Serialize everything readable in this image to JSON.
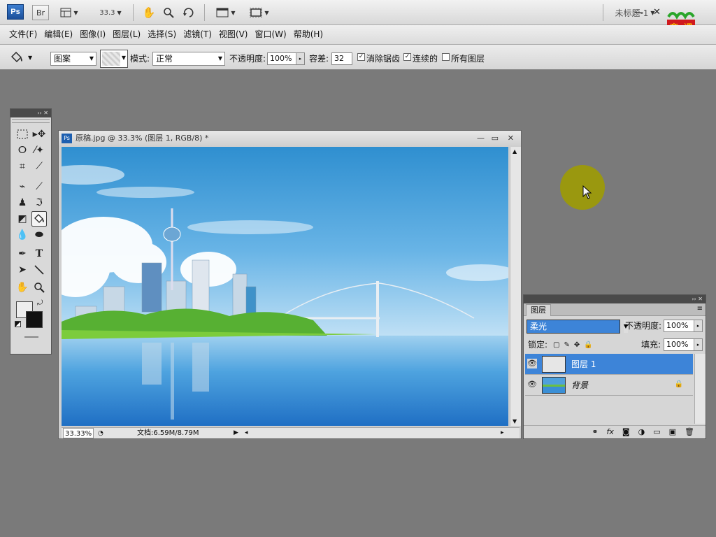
{
  "appbar": {
    "ps_logo": "Ps",
    "br_button": "Br",
    "zoom_value": "33.3",
    "doc_name": "未标题-1",
    "icons": [
      "bridge-icon",
      "layout-icon",
      "zoom-dropdown",
      "hand-icon",
      "zoom-icon",
      "rotate-icon",
      "arrange-icon",
      "screen-mode-icon"
    ]
  },
  "window_controls": {
    "minimize": "—",
    "restore": "❐",
    "close": "✕"
  },
  "menu": {
    "items": [
      "文件(F)",
      "编辑(E)",
      "图像(I)",
      "图层(L)",
      "选择(S)",
      "滤镜(T)",
      "视图(V)",
      "窗口(W)",
      "帮助(H)"
    ]
  },
  "options": {
    "fill_source": "图案",
    "mode_label": "模式:",
    "mode_value": "正常",
    "opacity_label": "不透明度:",
    "opacity_value": "100%",
    "tolerance_label": "容差:",
    "tolerance_value": "32",
    "antialias_label": "消除锯齿",
    "contiguous_label": "连续的",
    "all_layers_label": "所有图层",
    "antialias_checked": true,
    "contiguous_checked": true,
    "all_layers_checked": false
  },
  "logo": {
    "line1": "育",
    "line2": "课",
    "line3": "教育",
    "color": "#d0191e"
  },
  "tools_panel": {
    "active": "paint-bucket-tool"
  },
  "document": {
    "title": "原稿.jpg @ 33.3% (图层 1, RGB/8) *",
    "zoom": "33.33%",
    "doc_size": "文档:6.59M/8.79M"
  },
  "layers_panel": {
    "tab": "图层",
    "blend_mode": "柔光",
    "opacity_label": "不透明度:",
    "opacity_value": "100%",
    "lock_label": "锁定:",
    "fill_label": "填充:",
    "fill_value": "100%",
    "layers": [
      {
        "name": "图层 1",
        "selected": true
      },
      {
        "name": "背景",
        "selected": false,
        "locked": true
      }
    ]
  },
  "colors": {
    "workspace": "#7a7a7a",
    "selection": "#3d84d8",
    "cursor_highlight": "#9c9a0a"
  }
}
